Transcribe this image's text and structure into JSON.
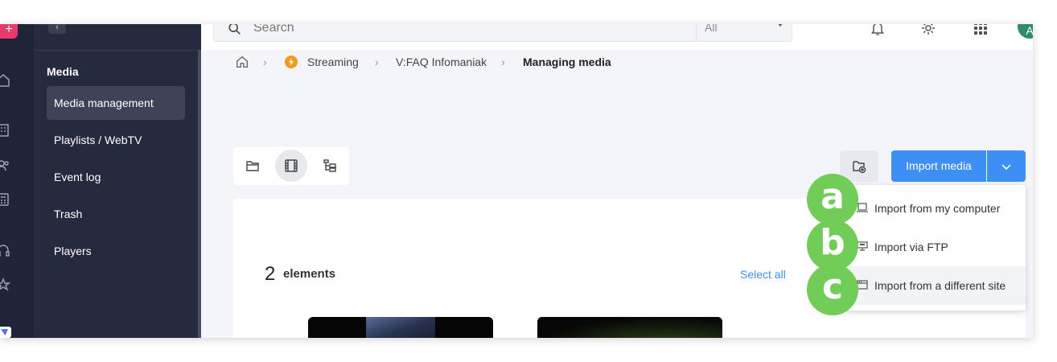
{
  "topbar": {
    "search_placeholder": "Search",
    "search_filter": "All",
    "avatar_initials": "A"
  },
  "sidebar": {
    "section_title": "Media",
    "items": [
      {
        "label": "Media management",
        "active": true
      },
      {
        "label": "Playlists / WebTV",
        "active": false
      },
      {
        "label": "Event log",
        "active": false
      },
      {
        "label": "Trash",
        "active": false
      },
      {
        "label": "Players",
        "active": false
      }
    ]
  },
  "breadcrumb": {
    "items": [
      "Streaming",
      "V:FAQ Infomaniak"
    ],
    "current": "Managing media"
  },
  "toolbar": {
    "import_label": "Import media"
  },
  "dropdown": {
    "items": [
      {
        "label": "Import from my computer",
        "icon": "laptop-icon",
        "marker": "a"
      },
      {
        "label": "Import via FTP",
        "icon": "ftp-icon",
        "marker": "b"
      },
      {
        "label": "Import from a different site",
        "icon": "web-icon",
        "marker": "c"
      }
    ]
  },
  "content": {
    "count": "2",
    "count_label": "elements",
    "select_all": "Select all"
  },
  "colors": {
    "accent": "#3d8ff3",
    "sidebar": "#262a3e",
    "rail": "#202439",
    "marker": "#72cc58",
    "brand": "#e9396f"
  }
}
